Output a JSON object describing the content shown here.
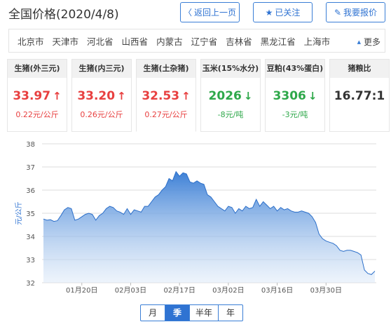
{
  "header": {
    "title": "全国价格(2020/4/8)",
    "buttons": [
      {
        "label": "返回上一页",
        "icon": "chevron-left-icon"
      },
      {
        "label": "已关注",
        "icon": "star-icon"
      },
      {
        "label": "我要报价",
        "icon": "edit-icon"
      }
    ]
  },
  "regions": {
    "items": [
      "北京市",
      "天津市",
      "河北省",
      "山西省",
      "内蒙古",
      "辽宁省",
      "吉林省",
      "黑龙江省",
      "上海市"
    ],
    "more_label": "更多",
    "more_icon": "triangle-up-icon"
  },
  "cards": [
    {
      "label": "生猪(外三元)",
      "value": "33.97",
      "change": "0.22元/公斤",
      "trend": "up"
    },
    {
      "label": "生猪(内三元)",
      "value": "33.20",
      "change": "0.26元/公斤",
      "trend": "up"
    },
    {
      "label": "生猪(土杂猪)",
      "value": "32.53",
      "change": "0.27元/公斤",
      "trend": "up"
    },
    {
      "label": "玉米(15%水分)",
      "value": "2026",
      "change": "-8元/吨",
      "trend": "down"
    },
    {
      "label": "豆粕(43%蛋白)",
      "value": "3306",
      "change": "-3元/吨",
      "trend": "down"
    },
    {
      "label": "猪粮比",
      "value": "16.77:1",
      "change": "",
      "trend": "none"
    }
  ],
  "colors": {
    "up": "#e84040",
    "down": "#2ea84a",
    "accent": "#2f73d2",
    "area": "#3d80d6"
  },
  "chart_data": {
    "type": "area",
    "ylabel": "元/公斤",
    "ylim": [
      32,
      38
    ],
    "yticks": [
      32,
      33,
      34,
      35,
      36,
      37,
      38
    ],
    "xticks": [
      {
        "label": "01月20日",
        "day": 11
      },
      {
        "label": "02月03日",
        "day": 25
      },
      {
        "label": "02月17日",
        "day": 39
      },
      {
        "label": "03月02日",
        "day": 53
      },
      {
        "label": "03月16日",
        "day": 67
      },
      {
        "label": "03月30日",
        "day": 81
      }
    ],
    "x_start": "2020-01-09",
    "x_end": "2020-04-08",
    "grid": true,
    "series": [
      {
        "values": [
          34.75,
          34.7,
          34.72,
          34.65,
          34.68,
          34.9,
          35.15,
          35.25,
          35.2,
          34.7,
          34.75,
          34.85,
          34.95,
          35.0,
          34.95,
          34.7,
          34.9,
          35.0,
          35.2,
          35.3,
          35.25,
          35.1,
          35.05,
          34.95,
          35.2,
          34.95,
          35.15,
          35.1,
          35.05,
          35.3,
          35.3,
          35.5,
          35.7,
          35.8,
          36.0,
          36.15,
          36.5,
          36.4,
          36.8,
          36.6,
          36.75,
          36.7,
          36.35,
          36.3,
          36.4,
          36.3,
          36.25,
          35.8,
          35.7,
          35.5,
          35.3,
          35.2,
          35.1,
          35.3,
          35.25,
          35.0,
          35.2,
          35.1,
          35.3,
          35.2,
          35.25,
          35.6,
          35.3,
          35.5,
          35.35,
          35.2,
          35.3,
          35.1,
          35.25,
          35.15,
          35.2,
          35.1,
          35.05,
          35.05,
          35.1,
          35.05,
          35.0,
          34.85,
          34.6,
          34.1,
          33.9,
          33.8,
          33.75,
          33.7,
          33.6,
          33.4,
          33.35,
          33.4,
          33.4,
          33.35,
          33.3,
          33.2,
          32.55,
          32.4,
          32.35,
          32.5
        ]
      }
    ]
  },
  "ranges": [
    {
      "label": "月",
      "active": false
    },
    {
      "label": "季",
      "active": true
    },
    {
      "label": "半年",
      "active": false
    },
    {
      "label": "年",
      "active": false
    }
  ]
}
